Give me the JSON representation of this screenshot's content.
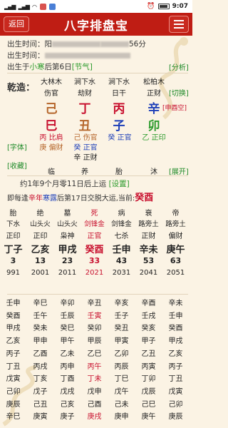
{
  "status": {
    "time": "9:07",
    "battery": ""
  },
  "appbar": {
    "back": "返回",
    "title": "八字排盘宝"
  },
  "info": {
    "line1_label": "出生时间：阳",
    "line1_tail": "56分",
    "line2_label": "出生时间：",
    "line3_pre": "出生于",
    "line3_term": "小寒",
    "line3_mid": "后第6日",
    "line3_tag": "[节气]",
    "analysis": "[分析]"
  },
  "nayin": [
    "大林木",
    "涧下水",
    "涧下水",
    "松柏木"
  ],
  "qianzao": "乾造：",
  "shishen_top": [
    "伤官",
    "劫财",
    "日干",
    "正财"
  ],
  "switch": "[切换]",
  "tiangan": [
    "己",
    "丁",
    "丙",
    "辛"
  ],
  "kongwang": "[申酉空]",
  "dizhi": [
    "巳",
    "丑",
    "子",
    "卯"
  ],
  "canggan": [
    [
      "丙 比肩",
      "庚 偏财"
    ],
    [
      "己 伤官",
      "癸 正官",
      "辛 正财"
    ],
    [
      "癸 正官"
    ],
    [
      "乙 正印"
    ]
  ],
  "font_tag": "[字体]",
  "collect_tag": "[收藏]",
  "expand_tag": "[展开]",
  "changsheng": [
    "临",
    "养",
    "胎",
    "沐"
  ],
  "qiyun": "约1年9个月零11日后上运",
  "set_tag": "[设置]",
  "jiaoyun": "即每逢辛年寒露后第17日交脱大运,当前:",
  "jiaoyun_year": "辛年",
  "jiaoyun_term": "寒露",
  "current": "癸酉",
  "dayun_stage": [
    "胎",
    "绝",
    "墓",
    "死",
    "病",
    "衰",
    "帝"
  ],
  "dayun_nayin": [
    "下水",
    "山头火",
    "山头火",
    "剑锋金",
    "剑锋金",
    "路旁土",
    "路旁土"
  ],
  "dayun_shishen": [
    "正印",
    "正印",
    "枭神",
    "正官",
    "七杀",
    "正财",
    "偏财"
  ],
  "dayun_ganzhi": [
    "丁子",
    "乙亥",
    "甲戌",
    "癸酉",
    "壬申",
    "辛未",
    "庚午"
  ],
  "dayun_age": [
    "3",
    "13",
    "23",
    "33",
    "43",
    "53",
    "63"
  ],
  "dayun_year": [
    "991",
    "2001",
    "2011",
    "2021",
    "2031",
    "2041",
    "2051"
  ],
  "liunian": [
    [
      "壬申",
      "辛巳",
      "辛卯",
      "辛丑",
      "辛亥",
      "辛酉",
      "辛未"
    ],
    [
      "癸酉",
      "壬午",
      "壬辰",
      "壬寅",
      "壬子",
      "壬戌",
      "壬申"
    ],
    [
      "甲戌",
      "癸未",
      "癸巳",
      "癸卯",
      "癸丑",
      "癸亥",
      "癸酉"
    ],
    [
      "乙亥",
      "甲申",
      "甲午",
      "甲辰",
      "甲寅",
      "甲子",
      "甲戌"
    ],
    [
      "丙子",
      "乙酉",
      "乙未",
      "乙巳",
      "乙卯",
      "乙丑",
      "乙亥"
    ],
    [
      "丁丑",
      "丙戌",
      "丙申",
      "丙午",
      "丙辰",
      "丙寅",
      "丙子"
    ],
    [
      "戊寅",
      "丁亥",
      "丁酉",
      "丁未",
      "丁巳",
      "丁卯",
      "丁丑"
    ],
    [
      "己卯",
      "戊子",
      "戊戌",
      "戊申",
      "戊午",
      "戊辰",
      "戊寅"
    ],
    [
      "庚辰",
      "己丑",
      "己亥",
      "己酉",
      "己未",
      "己巳",
      "己卯"
    ],
    [
      "辛巳",
      "庚寅",
      "庚子",
      "庚戌",
      "庚申",
      "庚午",
      "庚辰"
    ]
  ]
}
